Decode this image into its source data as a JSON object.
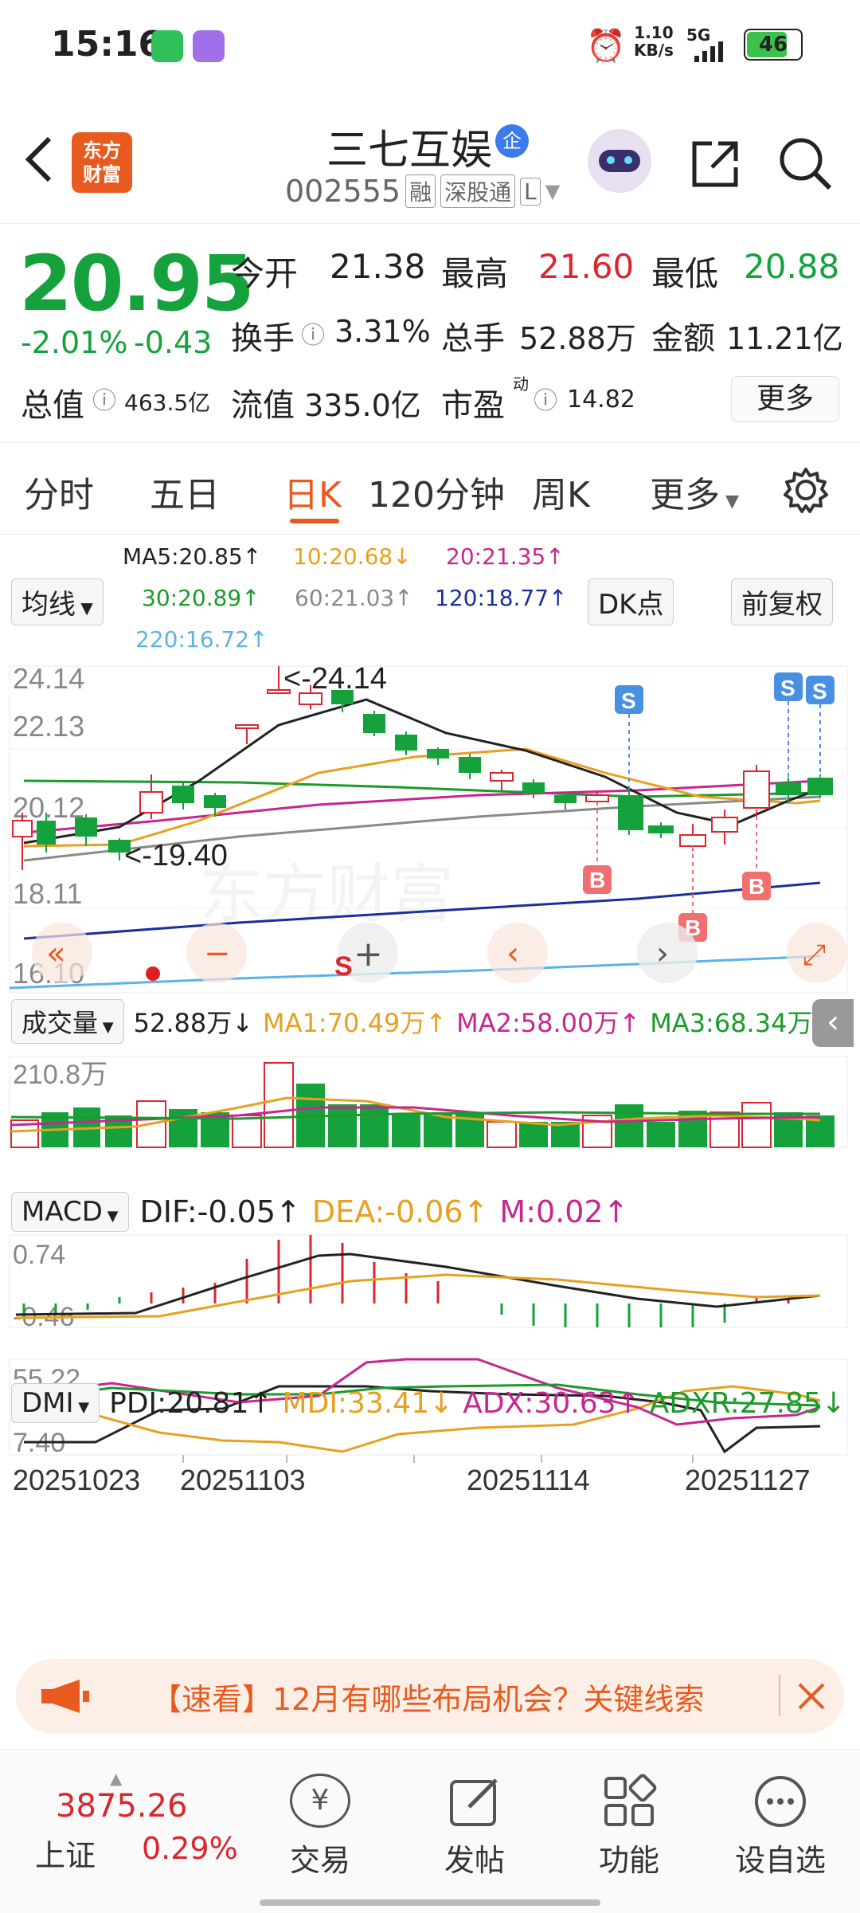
{
  "status_bar": {
    "time": "15:16",
    "network_speed_value": "1.10",
    "network_speed_unit": "KB/s",
    "network_type": "5G",
    "battery": "46"
  },
  "header": {
    "logo_line1": "东方",
    "logo_line2": "财富",
    "title": "三七互娱",
    "verified_badge": "企",
    "code": "002555",
    "tag_margin": "融",
    "tag_connect": "深股通",
    "tag_more": "L"
  },
  "quote": {
    "price": "20.95",
    "change_pct": "-2.01%",
    "change_abs": "-0.43",
    "open_label": "今开",
    "open": "21.38",
    "high_label": "最高",
    "high": "21.60",
    "low_label": "最低",
    "low": "20.88",
    "turnover_label": "换手",
    "turnover": "3.31%",
    "volume_label": "总手",
    "volume": "52.88万",
    "amount_label": "金额",
    "amount": "11.21亿",
    "mcap_label": "总值",
    "mcap": "463.5亿",
    "float_label": "流值",
    "float": "335.0亿",
    "pe_label": "市盈",
    "pe_sup": "动",
    "pe": "14.82",
    "more_button": "更多"
  },
  "tabs": [
    "分时",
    "五日",
    "日K",
    "120分钟",
    "周K",
    "更多"
  ],
  "active_tab": 2,
  "ma_legend": {
    "selector": "均线",
    "ma5": "MA5:20.85↑",
    "ma10": "10:20.68↓",
    "ma20": "20:21.35↑",
    "ma30": "30:20.89↑",
    "ma60": "60:21.03↑",
    "ma120": "120:18.77↑",
    "ma220": "220:16.72↑",
    "dk_button": "DK点",
    "fq_button": "前复权"
  },
  "kline": {
    "y_labels": [
      "24.14",
      "22.13",
      "20.12",
      "18.11",
      "16.10"
    ],
    "high_annotation": "<-24.14",
    "low_annotation": "<-19.40",
    "watermark": "东方财富",
    "buy_marker": "B",
    "sell_marker": "S",
    "controls": [
      "«",
      "−",
      "+",
      "‹",
      "›",
      "⤢"
    ]
  },
  "volume": {
    "selector": "成交量",
    "value": "52.88万↓",
    "ma1": "MA1:70.49万↑",
    "ma2": "MA2:58.00万↑",
    "ma3": "MA3:68.34万↓",
    "y_label": "210.8万"
  },
  "macd": {
    "selector": "MACD",
    "dif": "DIF:-0.05↑",
    "dea": "DEA:-0.06↑",
    "m": "M:0.02↑",
    "y_top": "0.74",
    "y_bottom": "-0.46"
  },
  "dmi": {
    "selector": "DMI",
    "pdi": "PDI:20.81↑",
    "mdi": "MDI:33.41↓",
    "adx": "ADX:30.63↑",
    "adxr": "ADXR:27.85↓",
    "y_top": "55.22",
    "y_bottom": "7.40"
  },
  "x_axis": [
    "20251023",
    "20251103",
    "20251114",
    "20251127"
  ],
  "banner": {
    "text": "【速看】12月有哪些布局机会？关键线索"
  },
  "bottom_nav": {
    "index_value": "3875.26",
    "index_name": "上证",
    "index_change": "0.29%",
    "items": [
      "交易",
      "发帖",
      "功能",
      "设自选"
    ]
  },
  "colors": {
    "up": "#d9262f",
    "down": "#15a23c",
    "ma5": "#222222",
    "ma10": "#e8a020",
    "ma20": "#c8268f",
    "ma30": "#1c9a2c",
    "ma60": "#8a8a8a",
    "ma120": "#1a2f9e",
    "ma220": "#5cb3e6",
    "accent": "#e85a1e"
  }
}
